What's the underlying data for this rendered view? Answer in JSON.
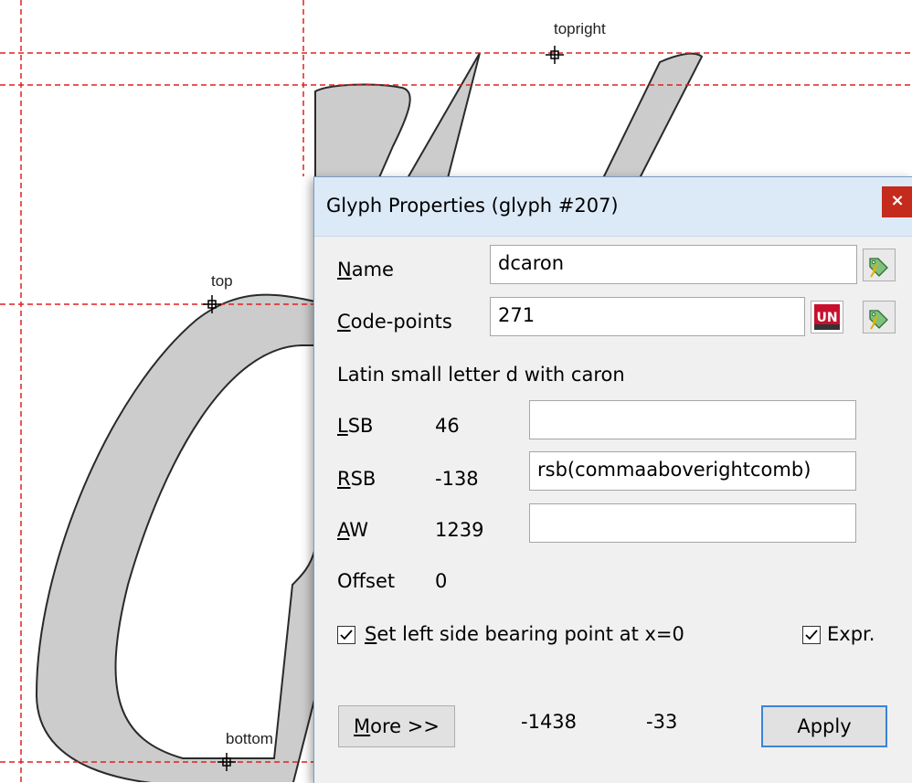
{
  "canvas": {
    "anchors": {
      "topright": "topright",
      "top": "top",
      "bottom": "bottom"
    }
  },
  "dialog": {
    "title": "Glyph Properties (glyph #207)",
    "close_label": "×",
    "name": {
      "label": "Name",
      "mnemonic": "N",
      "rest": "ame",
      "value": "dcaron"
    },
    "codepoints": {
      "label": "Code-points",
      "mnemonic": "C",
      "rest": "ode-points",
      "value": "271"
    },
    "description": "Latin small letter d with caron",
    "lsb": {
      "mnemonic": "L",
      "rest": "SB",
      "value": "46",
      "expr": ""
    },
    "rsb": {
      "mnemonic": "R",
      "rest": "SB",
      "value": "-138",
      "expr": "rsb(commaaboverightcomb)"
    },
    "aw": {
      "mnemonic": "A",
      "rest": "W",
      "value": "1239",
      "expr": ""
    },
    "offset": {
      "label": "Offset",
      "value": "0"
    },
    "set_lsb": {
      "mnemonic": "S",
      "rest": "et left side bearing point at x=0",
      "checked": true
    },
    "expr_toggle": {
      "label": "Expr.",
      "checked": true
    },
    "more_button": {
      "mnemonic": "M",
      "rest": "ore >>"
    },
    "coord_x": "-1438",
    "coord_y": "-33",
    "apply_button": "Apply"
  },
  "colors": {
    "guide": "#e02020",
    "glyph_fill": "#cccccc",
    "glyph_stroke": "#2a2a2a",
    "title_bg": "#dceaf8",
    "close_bg": "#c42b1c",
    "default_button_border": "#3a84d8"
  },
  "icons": [
    "tag-arrow-icon",
    "unicode-icon",
    "close-icon",
    "checkmark-icon"
  ]
}
